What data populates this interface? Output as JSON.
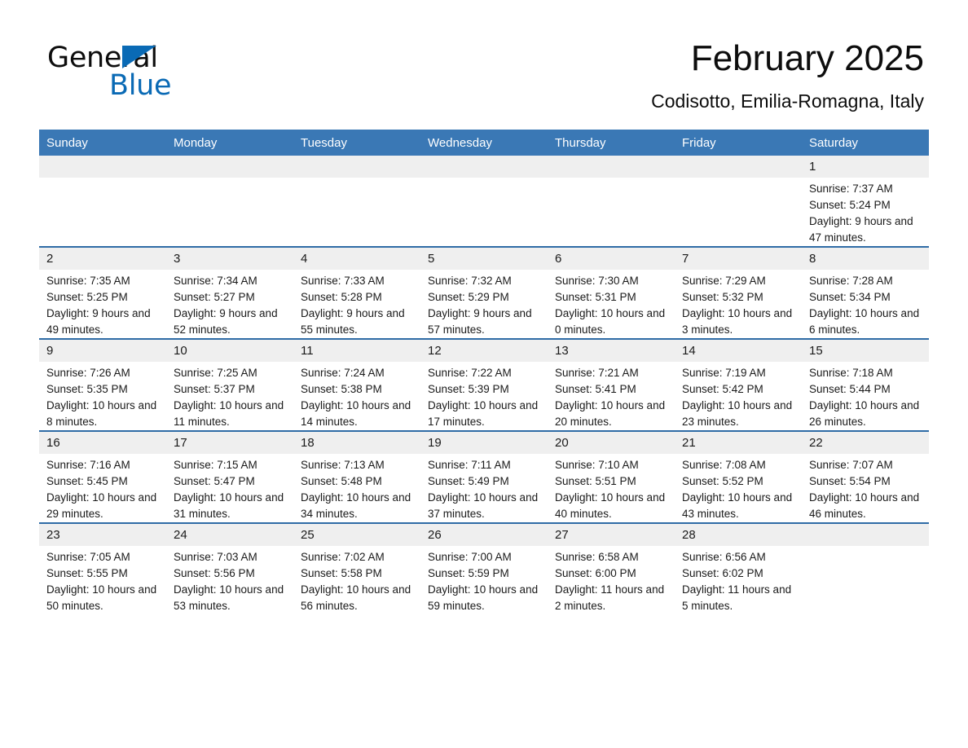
{
  "logo": {
    "word1": "General",
    "word2": "Blue",
    "triangle_color": "#0a6ab5"
  },
  "header": {
    "month_title": "February 2025",
    "location": "Codisotto, Emilia-Romagna, Italy"
  },
  "theme": {
    "header_blue": "#3a78b5",
    "row_border_blue": "#2f6ca6",
    "daynum_band": "#efefef"
  },
  "weekdays": [
    "Sunday",
    "Monday",
    "Tuesday",
    "Wednesday",
    "Thursday",
    "Friday",
    "Saturday"
  ],
  "labels": {
    "sunrise": "Sunrise:",
    "sunset": "Sunset:",
    "daylight": "Daylight:"
  },
  "weeks": [
    [
      {
        "day": "",
        "empty": true
      },
      {
        "day": "",
        "empty": true
      },
      {
        "day": "",
        "empty": true
      },
      {
        "day": "",
        "empty": true
      },
      {
        "day": "",
        "empty": true
      },
      {
        "day": "",
        "empty": true
      },
      {
        "day": "1",
        "sunrise": "Sunrise: 7:37 AM",
        "sunset": "Sunset: 5:24 PM",
        "daylight": "Daylight: 9 hours and 47 minutes."
      }
    ],
    [
      {
        "day": "2",
        "sunrise": "Sunrise: 7:35 AM",
        "sunset": "Sunset: 5:25 PM",
        "daylight": "Daylight: 9 hours and 49 minutes."
      },
      {
        "day": "3",
        "sunrise": "Sunrise: 7:34 AM",
        "sunset": "Sunset: 5:27 PM",
        "daylight": "Daylight: 9 hours and 52 minutes."
      },
      {
        "day": "4",
        "sunrise": "Sunrise: 7:33 AM",
        "sunset": "Sunset: 5:28 PM",
        "daylight": "Daylight: 9 hours and 55 minutes."
      },
      {
        "day": "5",
        "sunrise": "Sunrise: 7:32 AM",
        "sunset": "Sunset: 5:29 PM",
        "daylight": "Daylight: 9 hours and 57 minutes."
      },
      {
        "day": "6",
        "sunrise": "Sunrise: 7:30 AM",
        "sunset": "Sunset: 5:31 PM",
        "daylight": "Daylight: 10 hours and 0 minutes."
      },
      {
        "day": "7",
        "sunrise": "Sunrise: 7:29 AM",
        "sunset": "Sunset: 5:32 PM",
        "daylight": "Daylight: 10 hours and 3 minutes."
      },
      {
        "day": "8",
        "sunrise": "Sunrise: 7:28 AM",
        "sunset": "Sunset: 5:34 PM",
        "daylight": "Daylight: 10 hours and 6 minutes."
      }
    ],
    [
      {
        "day": "9",
        "sunrise": "Sunrise: 7:26 AM",
        "sunset": "Sunset: 5:35 PM",
        "daylight": "Daylight: 10 hours and 8 minutes."
      },
      {
        "day": "10",
        "sunrise": "Sunrise: 7:25 AM",
        "sunset": "Sunset: 5:37 PM",
        "daylight": "Daylight: 10 hours and 11 minutes."
      },
      {
        "day": "11",
        "sunrise": "Sunrise: 7:24 AM",
        "sunset": "Sunset: 5:38 PM",
        "daylight": "Daylight: 10 hours and 14 minutes."
      },
      {
        "day": "12",
        "sunrise": "Sunrise: 7:22 AM",
        "sunset": "Sunset: 5:39 PM",
        "daylight": "Daylight: 10 hours and 17 minutes."
      },
      {
        "day": "13",
        "sunrise": "Sunrise: 7:21 AM",
        "sunset": "Sunset: 5:41 PM",
        "daylight": "Daylight: 10 hours and 20 minutes."
      },
      {
        "day": "14",
        "sunrise": "Sunrise: 7:19 AM",
        "sunset": "Sunset: 5:42 PM",
        "daylight": "Daylight: 10 hours and 23 minutes."
      },
      {
        "day": "15",
        "sunrise": "Sunrise: 7:18 AM",
        "sunset": "Sunset: 5:44 PM",
        "daylight": "Daylight: 10 hours and 26 minutes."
      }
    ],
    [
      {
        "day": "16",
        "sunrise": "Sunrise: 7:16 AM",
        "sunset": "Sunset: 5:45 PM",
        "daylight": "Daylight: 10 hours and 29 minutes."
      },
      {
        "day": "17",
        "sunrise": "Sunrise: 7:15 AM",
        "sunset": "Sunset: 5:47 PM",
        "daylight": "Daylight: 10 hours and 31 minutes."
      },
      {
        "day": "18",
        "sunrise": "Sunrise: 7:13 AM",
        "sunset": "Sunset: 5:48 PM",
        "daylight": "Daylight: 10 hours and 34 minutes."
      },
      {
        "day": "19",
        "sunrise": "Sunrise: 7:11 AM",
        "sunset": "Sunset: 5:49 PM",
        "daylight": "Daylight: 10 hours and 37 minutes."
      },
      {
        "day": "20",
        "sunrise": "Sunrise: 7:10 AM",
        "sunset": "Sunset: 5:51 PM",
        "daylight": "Daylight: 10 hours and 40 minutes."
      },
      {
        "day": "21",
        "sunrise": "Sunrise: 7:08 AM",
        "sunset": "Sunset: 5:52 PM",
        "daylight": "Daylight: 10 hours and 43 minutes."
      },
      {
        "day": "22",
        "sunrise": "Sunrise: 7:07 AM",
        "sunset": "Sunset: 5:54 PM",
        "daylight": "Daylight: 10 hours and 46 minutes."
      }
    ],
    [
      {
        "day": "23",
        "sunrise": "Sunrise: 7:05 AM",
        "sunset": "Sunset: 5:55 PM",
        "daylight": "Daylight: 10 hours and 50 minutes."
      },
      {
        "day": "24",
        "sunrise": "Sunrise: 7:03 AM",
        "sunset": "Sunset: 5:56 PM",
        "daylight": "Daylight: 10 hours and 53 minutes."
      },
      {
        "day": "25",
        "sunrise": "Sunrise: 7:02 AM",
        "sunset": "Sunset: 5:58 PM",
        "daylight": "Daylight: 10 hours and 56 minutes."
      },
      {
        "day": "26",
        "sunrise": "Sunrise: 7:00 AM",
        "sunset": "Sunset: 5:59 PM",
        "daylight": "Daylight: 10 hours and 59 minutes."
      },
      {
        "day": "27",
        "sunrise": "Sunrise: 6:58 AM",
        "sunset": "Sunset: 6:00 PM",
        "daylight": "Daylight: 11 hours and 2 minutes."
      },
      {
        "day": "28",
        "sunrise": "Sunrise: 6:56 AM",
        "sunset": "Sunset: 6:02 PM",
        "daylight": "Daylight: 11 hours and 5 minutes."
      },
      {
        "day": "",
        "empty": true
      }
    ]
  ]
}
